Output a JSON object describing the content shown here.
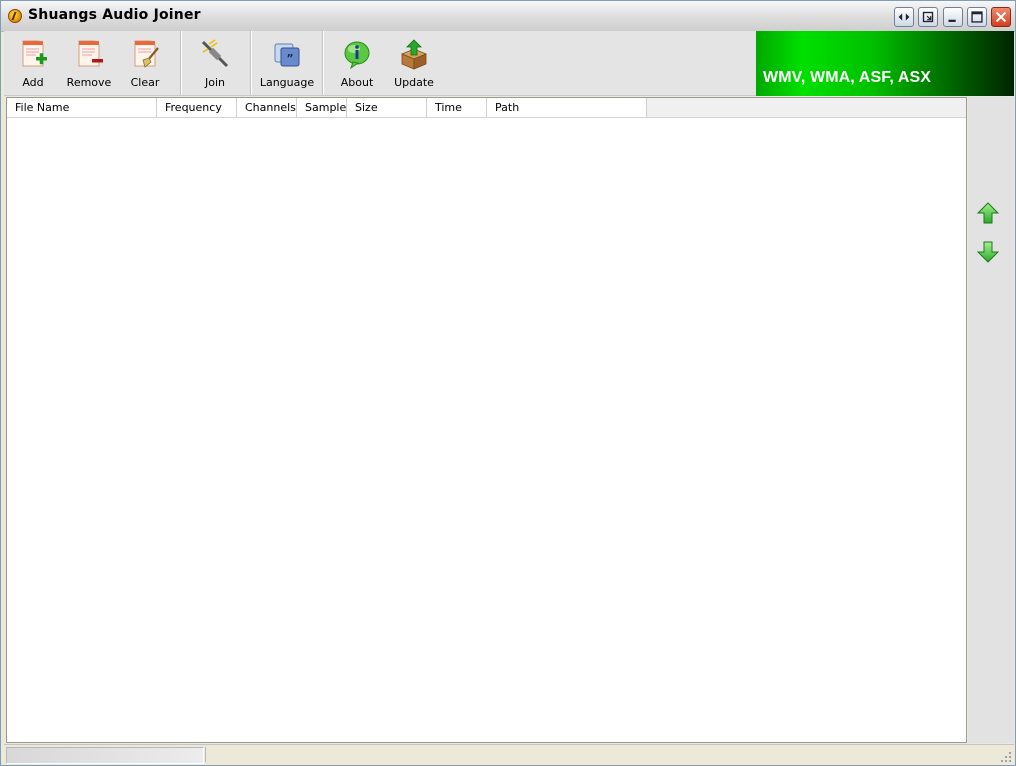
{
  "window": {
    "title": "Shuangs Audio Joiner"
  },
  "titlebar_buttons": [
    {
      "name": "skin-button",
      "icon": "left-right-arrows-icon"
    },
    {
      "name": "restore-down-button",
      "icon": "window-restore-icon"
    },
    {
      "name": "minimize-button",
      "icon": "minimize-icon"
    },
    {
      "name": "maximize-button",
      "icon": "maximize-icon"
    },
    {
      "name": "close-button",
      "icon": "close-icon"
    }
  ],
  "toolbar": {
    "add": {
      "label": "Add",
      "icon": "add-file-icon"
    },
    "remove": {
      "label": "Remove",
      "icon": "remove-file-icon"
    },
    "clear": {
      "label": "Clear",
      "icon": "clear-list-icon"
    },
    "join": {
      "label": "Join",
      "icon": "join-plug-icon"
    },
    "language": {
      "label": "Language",
      "icon": "language-icon"
    },
    "about": {
      "label": "About",
      "icon": "info-icon"
    },
    "update": {
      "label": "Update",
      "icon": "update-box-icon"
    }
  },
  "banner": {
    "text": "WMV, WMA, ASF, ASX",
    "colors": {
      "start": "#00e000",
      "end": "#002400"
    }
  },
  "file_list": {
    "columns": [
      "File Name",
      "Frequency",
      "Channels",
      "Sample",
      "Size",
      "Time",
      "Path"
    ],
    "rows": []
  },
  "side_panel": {
    "move_up": {
      "icon": "arrow-up-icon"
    },
    "move_down": {
      "icon": "arrow-down-icon"
    }
  },
  "statusbar": {
    "pane1": "",
    "pane2": ""
  },
  "colors": {
    "accent_green": "#2eb82e",
    "window_bg": "#ece9d8"
  }
}
